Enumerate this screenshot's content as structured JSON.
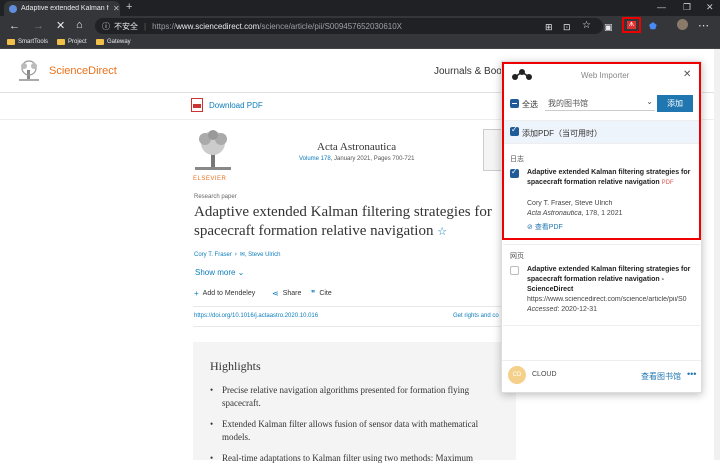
{
  "browser": {
    "tab_title": "Adaptive extended Kalman filte",
    "new_tab_symbol": "+",
    "nav": {
      "back": "←",
      "forward": "→",
      "reload": "✕",
      "home": "⌂"
    },
    "omnibox": {
      "security_label": "不安全",
      "url_prefix": "https://",
      "url_host": "www.sciencedirect.com",
      "url_path": "/science/article/pii/S009457652030610X"
    },
    "bookmarks": [
      "SmartTools",
      "Project",
      "Gateway"
    ]
  },
  "site": {
    "brand": "ScienceDirect",
    "journals_link": "Journals & Book",
    "download_pdf": "Download PDF",
    "publisher": "ELSEVIER",
    "journal_name": "Acta Astronautica",
    "volume_link": "Volume 178",
    "volume_rest": ", January 2021, Pages 700-721",
    "article_type": "Research paper",
    "title": "Adaptive extended Kalman filtering strategies for spacecraft formation relative navigation",
    "title_star": "☆",
    "authors": "Cory T. Fraser ♀ ✉, Steve Ulrich",
    "show_more": "Show more ⌄",
    "actions": {
      "mendeley": "Add to Mendeley",
      "share": "Share",
      "cite": "Cite"
    },
    "doi": "https://doi.org/10.1016/j.actaastro.2020.10.016",
    "get_rights": "Get rights and co",
    "highlights_title": "Highlights",
    "highlights": [
      "Precise relative navigation algorithms presented for formation flying spacecraft.",
      "Extended Kalman filter allows fusion of sensor data with mathematical models.",
      "Real-time adaptations to Kalman filter using two methods: Maximum"
    ]
  },
  "importer": {
    "title": "Web Importer",
    "close": "✕",
    "select_all": "全选",
    "library": "我的图书馆",
    "library_arrow": "⌄",
    "add_button": "添加",
    "add_pdf": "添加PDF（当可用时）",
    "section_journal": "日志",
    "item1": {
      "title": "Adaptive extended Kalman filtering strategies for spacecraft formation relative navigation",
      "badge": "PDF",
      "authors": "Cory T. Fraser, Steve Ulrich",
      "journal": "Acta Astronautica",
      "citation": ", 178, 1 2021",
      "view_pdf": "查看PDF"
    },
    "section_web": "网页",
    "item2": {
      "title": "Adaptive extended Kalman filtering strategies for spacecraft formation relative navigation - ScienceDirect",
      "url": "https://www.sciencedirect.com/science/article/pii/S0",
      "accessed_label": "Accessed",
      "accessed_date": ": 2020-12-31"
    },
    "cloud_avatar": "CD",
    "cloud_label": "CLOUD",
    "view_library": "查看图书馆",
    "more": "•••"
  }
}
